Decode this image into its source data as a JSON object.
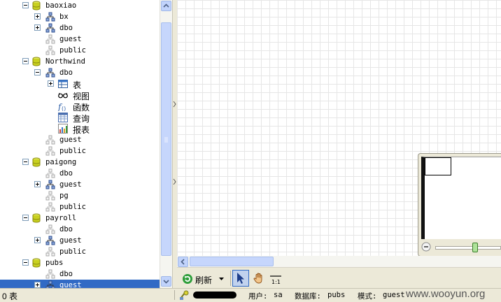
{
  "tree": {
    "items": [
      {
        "label": "baoxiao",
        "type": "database",
        "level": 0,
        "toggle": "minus"
      },
      {
        "label": "bx",
        "type": "schema",
        "level": 1,
        "toggle": "plus"
      },
      {
        "label": "dbo",
        "type": "schema",
        "level": 1,
        "toggle": "plus"
      },
      {
        "label": "guest",
        "type": "user",
        "level": 1,
        "toggle": ""
      },
      {
        "label": "public",
        "type": "user",
        "level": 1,
        "toggle": ""
      },
      {
        "label": "Northwind",
        "type": "database",
        "level": 0,
        "toggle": "minus"
      },
      {
        "label": "dbo",
        "type": "schema",
        "level": 1,
        "toggle": "minus"
      },
      {
        "label": "表",
        "type": "table",
        "level": 2,
        "toggle": "plus"
      },
      {
        "label": "视图",
        "type": "view",
        "level": 2,
        "toggle": ""
      },
      {
        "label": "函数",
        "type": "function",
        "level": 2,
        "toggle": ""
      },
      {
        "label": "查询",
        "type": "query",
        "level": 2,
        "toggle": ""
      },
      {
        "label": "报表",
        "type": "report",
        "level": 2,
        "toggle": ""
      },
      {
        "label": "guest",
        "type": "user",
        "level": 1,
        "toggle": ""
      },
      {
        "label": "public",
        "type": "user",
        "level": 1,
        "toggle": ""
      },
      {
        "label": "paigong",
        "type": "database",
        "level": 0,
        "toggle": "minus"
      },
      {
        "label": "dbo",
        "type": "user",
        "level": 1,
        "toggle": ""
      },
      {
        "label": "guest",
        "type": "schema",
        "level": 1,
        "toggle": "plus"
      },
      {
        "label": "pg",
        "type": "user",
        "level": 1,
        "toggle": ""
      },
      {
        "label": "public",
        "type": "user",
        "level": 1,
        "toggle": ""
      },
      {
        "label": "payroll",
        "type": "database",
        "level": 0,
        "toggle": "minus"
      },
      {
        "label": "dbo",
        "type": "user",
        "level": 1,
        "toggle": ""
      },
      {
        "label": "guest",
        "type": "schema",
        "level": 1,
        "toggle": "plus"
      },
      {
        "label": "public",
        "type": "user",
        "level": 1,
        "toggle": ""
      },
      {
        "label": "pubs",
        "type": "database",
        "level": 0,
        "toggle": "minus"
      },
      {
        "label": "dbo",
        "type": "user",
        "level": 1,
        "toggle": ""
      },
      {
        "label": "guest",
        "type": "schema",
        "level": 1,
        "toggle": "plus",
        "selected": true
      }
    ]
  },
  "toolbar": {
    "refresh_label": "刷新"
  },
  "status": {
    "count": "0 表",
    "user_label": "用户:",
    "user_value": "sa",
    "db_label": "数据库:",
    "db_value": "pubs",
    "mode_label": "模式:",
    "mode_value": "guest",
    "watermark": "www.wooyun.org"
  },
  "colors": {
    "selection": "#316ac5",
    "database": "#c8d020",
    "grid": "#e6e6e6",
    "scroll": "#c6d6fc"
  }
}
